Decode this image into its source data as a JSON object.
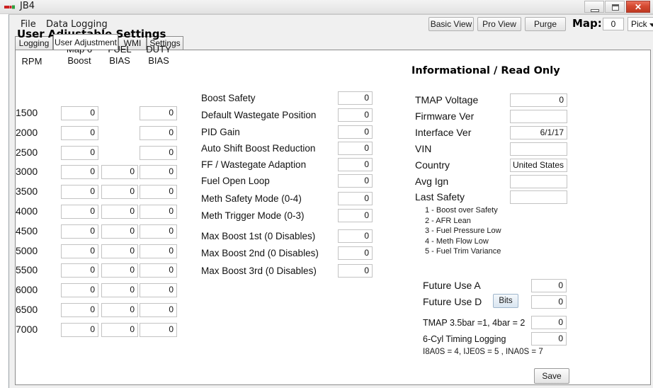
{
  "window": {
    "title": "JB4",
    "icon": "app-logo-icon",
    "controls": {
      "minimize": "minimize-icon",
      "maximize": "maximize-icon",
      "close": "✕"
    }
  },
  "menu": {
    "items": [
      {
        "label": "File"
      },
      {
        "label": "Data Logging"
      }
    ]
  },
  "toolbar": {
    "basic_view": "Basic View",
    "pro_view": "Pro View",
    "purge": "Purge",
    "map_label": "Map:",
    "map_value": "0",
    "pick_label": "Pick",
    "pick_arrow": "chevron-down-icon"
  },
  "tabs": [
    {
      "label": "Logging",
      "active": false
    },
    {
      "label": "User Adjustment",
      "active": true
    },
    {
      "label": "WMI",
      "active": false
    },
    {
      "label": "Settings",
      "active": false
    }
  ],
  "user_adjustable": {
    "heading": "User Adjustable Settings",
    "columns": [
      "RPM",
      "Map 6 Boost",
      "FUEL BIAS",
      "DUTY BIAS"
    ],
    "column_lines": {
      "rpm": "RPM",
      "map6_l1": "Map 6",
      "map6_l2": "Boost",
      "fuel_l1": "FUEL",
      "fuel_l2": "BIAS",
      "duty_l1": "DUTY",
      "duty_l2": "BIAS"
    },
    "rows": [
      {
        "rpm": "1500",
        "map6_boost": "0",
        "fuel_bias": null,
        "duty_bias": "0"
      },
      {
        "rpm": "2000",
        "map6_boost": "0",
        "fuel_bias": null,
        "duty_bias": "0"
      },
      {
        "rpm": "2500",
        "map6_boost": "0",
        "fuel_bias": null,
        "duty_bias": "0"
      },
      {
        "rpm": "3000",
        "map6_boost": "0",
        "fuel_bias": "0",
        "duty_bias": "0"
      },
      {
        "rpm": "3500",
        "map6_boost": "0",
        "fuel_bias": "0",
        "duty_bias": "0"
      },
      {
        "rpm": "4000",
        "map6_boost": "0",
        "fuel_bias": "0",
        "duty_bias": "0"
      },
      {
        "rpm": "4500",
        "map6_boost": "0",
        "fuel_bias": "0",
        "duty_bias": "0"
      },
      {
        "rpm": "5000",
        "map6_boost": "0",
        "fuel_bias": "0",
        "duty_bias": "0"
      },
      {
        "rpm": "5500",
        "map6_boost": "0",
        "fuel_bias": "0",
        "duty_bias": "0"
      },
      {
        "rpm": "6000",
        "map6_boost": "0",
        "fuel_bias": "0",
        "duty_bias": "0"
      },
      {
        "rpm": "6500",
        "map6_boost": "0",
        "fuel_bias": "0",
        "duty_bias": "0"
      },
      {
        "rpm": "7000",
        "map6_boost": "0",
        "fuel_bias": "0",
        "duty_bias": "0"
      }
    ]
  },
  "settings_list": [
    {
      "label": "Boost Safety",
      "value": "0"
    },
    {
      "label": "Default Wastegate Position",
      "value": "0"
    },
    {
      "label": "PID Gain",
      "value": "0"
    },
    {
      "label": "Auto Shift Boost Reduction",
      "value": "0"
    },
    {
      "label": "FF / Wastegate Adaption",
      "value": "0"
    },
    {
      "label": "Fuel Open Loop",
      "value": "0"
    },
    {
      "label": "Meth Safety Mode (0-4)",
      "value": "0"
    },
    {
      "label": "Meth Trigger Mode (0-3)",
      "value": "0"
    },
    {
      "label": "Max Boost 1st (0 Disables)",
      "value": "0"
    },
    {
      "label": "Max Boost 2nd (0 Disables)",
      "value": "0"
    },
    {
      "label": "Max Boost 3rd (0 Disables)",
      "value": "0"
    }
  ],
  "informational": {
    "heading": "Informational / Read Only",
    "fields": [
      {
        "label": "TMAP Voltage",
        "value": "0"
      },
      {
        "label": "Firmware Ver",
        "value": ""
      },
      {
        "label": "Interface Ver",
        "value": "6/1/17"
      },
      {
        "label": "VIN",
        "value": ""
      },
      {
        "label": "Country",
        "value": "United States"
      },
      {
        "label": "Avg Ign",
        "value": ""
      },
      {
        "label": "Last Safety",
        "value": ""
      }
    ],
    "safety_codes": [
      "1 - Boost over Safety",
      "2 - AFR Lean",
      "3 - Fuel Pressure Low",
      "4 - Meth Flow Low",
      "5 - Fuel Trim Variance"
    ]
  },
  "future_use": {
    "rows": [
      {
        "label": "Future Use A",
        "value": "0"
      },
      {
        "label": "Future Use D",
        "value": "0"
      },
      {
        "label": "TMAP 3.5bar =1, 4bar = 2",
        "value": "0"
      },
      {
        "label": "6-Cyl Timing Logging",
        "value": "0"
      }
    ],
    "bits_button": "Bits",
    "footnote": "I8A0S = 4, IJE0S = 5 , INA0S = 7"
  },
  "save_button": "Save"
}
